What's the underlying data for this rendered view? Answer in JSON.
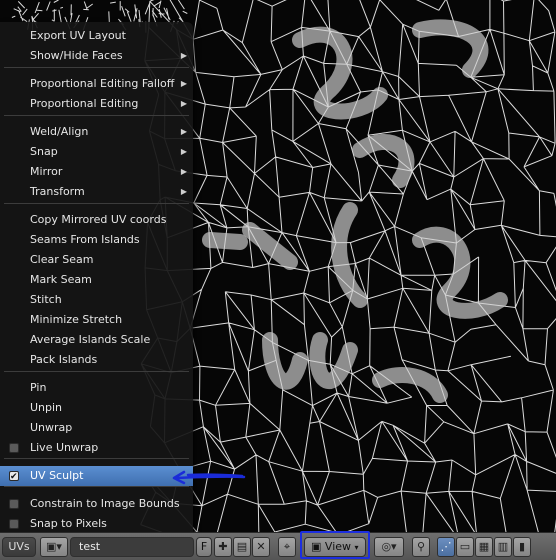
{
  "menu": {
    "items": [
      {
        "label": "Export UV Layout",
        "submenu": false
      },
      {
        "label": "Show/Hide Faces",
        "submenu": true
      },
      {
        "label": "Proportional Editing Falloff",
        "submenu": true
      },
      {
        "label": "Proportional Editing",
        "submenu": true
      },
      {
        "label": "Weld/Align",
        "submenu": true
      },
      {
        "label": "Snap",
        "submenu": true
      },
      {
        "label": "Mirror",
        "submenu": true
      },
      {
        "label": "Transform",
        "submenu": true
      },
      {
        "label": "Copy Mirrored UV coords",
        "submenu": false
      },
      {
        "label": "Seams From Islands",
        "submenu": false
      },
      {
        "label": "Clear Seam",
        "submenu": false
      },
      {
        "label": "Mark Seam",
        "submenu": false
      },
      {
        "label": "Stitch",
        "submenu": false
      },
      {
        "label": "Minimize Stretch",
        "submenu": false
      },
      {
        "label": "Average Islands Scale",
        "submenu": false
      },
      {
        "label": "Pack Islands",
        "submenu": false
      },
      {
        "label": "Pin",
        "submenu": false
      },
      {
        "label": "Unpin",
        "submenu": false
      },
      {
        "label": "Unwrap",
        "submenu": false
      },
      {
        "label": "Live Unwrap",
        "checkbox": true,
        "checked": false
      },
      {
        "label": "UV Sculpt",
        "checkbox": true,
        "checked": true,
        "highlighted": true
      },
      {
        "label": "Constrain to Image Bounds",
        "checkbox": true,
        "checked": false
      },
      {
        "label": "Snap to Pixels",
        "checkbox": true,
        "checked": false
      }
    ]
  },
  "header": {
    "uvs_menu": "UVs",
    "image_name": "test",
    "fake_user": "F",
    "view_select": "View",
    "icons": [
      "image-browse-icon",
      "new-image-icon",
      "open-image-icon",
      "unlink-icon",
      "pin-icon",
      "pivot-icon",
      "sticky-selection-icon",
      "vertex-select-icon",
      "edge-select-icon",
      "face-select-icon",
      "island-select-icon"
    ]
  },
  "annotation": {
    "arrow_color": "#1a2bd8",
    "outline_color": "#1c2ee0"
  },
  "accent": "#5b8fd1"
}
